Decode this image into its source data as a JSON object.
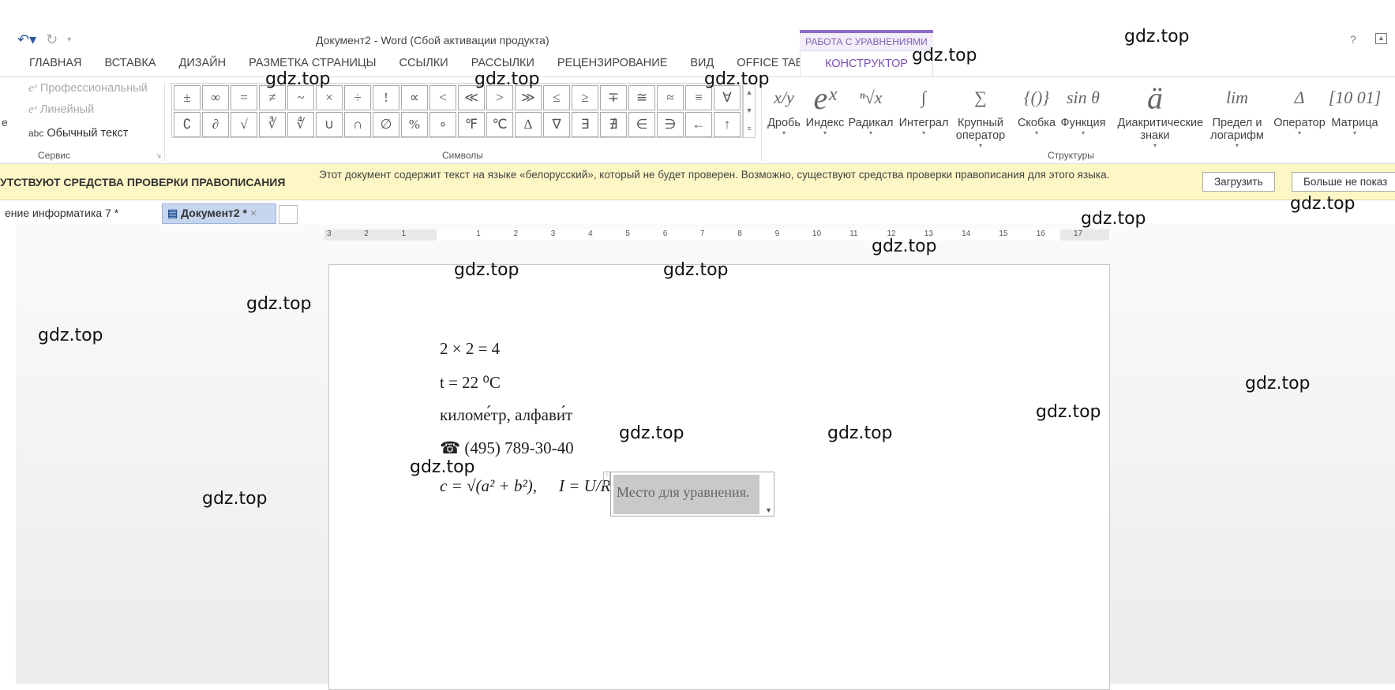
{
  "titlebar": {
    "title": "Документ2 - Word (Сбой активации продукта)",
    "undo_icon": "undo-icon",
    "redo_icon": "redo-icon",
    "help": "?",
    "context_group": "РАБОТА С УРАВНЕНИЯМИ"
  },
  "tabs": [
    "ГЛАВНАЯ",
    "ВСТАВКА",
    "ДИЗАЙН",
    "РАЗМЕТКА СТРАНИЦЫ",
    "ССЫЛКИ",
    "РАССЫЛКИ",
    "РЕЦЕНЗИРОВАНИЕ",
    "ВИД",
    "OFFICE TAB"
  ],
  "active_tab": "КОНСТРУКТОР",
  "service": {
    "items": [
      "Профессиональный",
      "Линейный",
      "Обычный текст"
    ],
    "plain_prefix": "abc",
    "cut_label": "е",
    "group": "Сервис"
  },
  "symbols": {
    "group": "Символы",
    "row1": [
      "±",
      "∞",
      "=",
      "≠",
      "~",
      "×",
      "÷",
      "!",
      "∝",
      "<",
      "≪",
      ">",
      "≫",
      "≤",
      "≥",
      "∓",
      "≅",
      "≈",
      "≡",
      "∀"
    ],
    "row2": [
      "∁",
      "∂",
      "√",
      "∛",
      "∜",
      "∪",
      "∩",
      "∅",
      "%",
      "∘",
      "℉",
      "℃",
      "∆",
      "∇",
      "∃",
      "∄",
      "∈",
      "∋",
      "←",
      "↑"
    ]
  },
  "structures": {
    "group": "Структуры",
    "items": [
      {
        "glyph": "x/y",
        "label": "Дробь"
      },
      {
        "glyph": "eˣ",
        "label": "Индекс"
      },
      {
        "glyph": "ⁿ√x",
        "label": "Радикал"
      },
      {
        "glyph": "∫",
        "label": "Интеграл"
      },
      {
        "glyph": "∑",
        "label": "Крупный оператор"
      },
      {
        "glyph": "{()}",
        "label": "Скобка"
      },
      {
        "glyph": "sin θ",
        "label": "Функция"
      },
      {
        "glyph": "ä",
        "label": "Диакритические знаки"
      },
      {
        "glyph": "lim",
        "label": "Предел и логарифм"
      },
      {
        "glyph": "Δ",
        "label": "Оператор"
      },
      {
        "glyph": "[10 01]",
        "label": "Матрица"
      }
    ]
  },
  "message_bar": {
    "title": "УТСТВУЮТ СРЕДСТВА ПРОВЕРКИ ПРАВОПИСАНИЯ",
    "text": "Этот документ содержит текст на языке «белорусский», который не будет проверен. Возможно, существуют средства проверки правописания для этого языка.",
    "download": "Загрузить",
    "dont_show": "Больше не показ"
  },
  "doc_tabs": [
    {
      "label": "ение информатика 7 *"
    },
    {
      "label": "Документ2 *",
      "close": "×"
    }
  ],
  "ruler": [
    "3",
    "2",
    "1",
    "",
    "1",
    "2",
    "3",
    "4",
    "5",
    "6",
    "7",
    "8",
    "9",
    "10",
    "11",
    "12",
    "13",
    "14",
    "15",
    "16",
    "17"
  ],
  "document": {
    "lines": [
      "2 × 2 = 4",
      "t = 22 ⁰C",
      "киломе́тр, алфави́т",
      "☎ (495) 789-30-40"
    ],
    "formula_c": "c = √(a² + b²),",
    "formula_i": "I = U/R,",
    "placeholder": "Место для уравнения."
  },
  "watermark": "gdz.top"
}
